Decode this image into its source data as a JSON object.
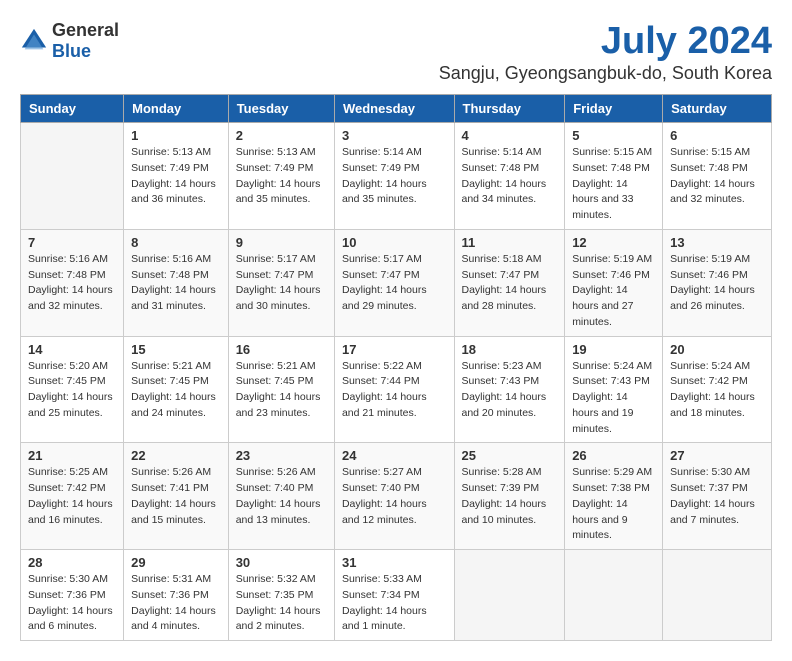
{
  "logo": {
    "general": "General",
    "blue": "Blue"
  },
  "title": "July 2024",
  "subtitle": "Sangju, Gyeongsangbuk-do, South Korea",
  "header": {
    "days": [
      "Sunday",
      "Monday",
      "Tuesday",
      "Wednesday",
      "Thursday",
      "Friday",
      "Saturday"
    ]
  },
  "weeks": [
    {
      "cells": [
        {
          "empty": true
        },
        {
          "day": "1",
          "rise": "Sunrise: 5:13 AM",
          "set": "Sunset: 7:49 PM",
          "daylight": "Daylight: 14 hours and 36 minutes."
        },
        {
          "day": "2",
          "rise": "Sunrise: 5:13 AM",
          "set": "Sunset: 7:49 PM",
          "daylight": "Daylight: 14 hours and 35 minutes."
        },
        {
          "day": "3",
          "rise": "Sunrise: 5:14 AM",
          "set": "Sunset: 7:49 PM",
          "daylight": "Daylight: 14 hours and 35 minutes."
        },
        {
          "day": "4",
          "rise": "Sunrise: 5:14 AM",
          "set": "Sunset: 7:48 PM",
          "daylight": "Daylight: 14 hours and 34 minutes."
        },
        {
          "day": "5",
          "rise": "Sunrise: 5:15 AM",
          "set": "Sunset: 7:48 PM",
          "daylight": "Daylight: 14 hours and 33 minutes."
        },
        {
          "day": "6",
          "rise": "Sunrise: 5:15 AM",
          "set": "Sunset: 7:48 PM",
          "daylight": "Daylight: 14 hours and 32 minutes."
        }
      ]
    },
    {
      "cells": [
        {
          "day": "7",
          "rise": "Sunrise: 5:16 AM",
          "set": "Sunset: 7:48 PM",
          "daylight": "Daylight: 14 hours and 32 minutes."
        },
        {
          "day": "8",
          "rise": "Sunrise: 5:16 AM",
          "set": "Sunset: 7:48 PM",
          "daylight": "Daylight: 14 hours and 31 minutes."
        },
        {
          "day": "9",
          "rise": "Sunrise: 5:17 AM",
          "set": "Sunset: 7:47 PM",
          "daylight": "Daylight: 14 hours and 30 minutes."
        },
        {
          "day": "10",
          "rise": "Sunrise: 5:17 AM",
          "set": "Sunset: 7:47 PM",
          "daylight": "Daylight: 14 hours and 29 minutes."
        },
        {
          "day": "11",
          "rise": "Sunrise: 5:18 AM",
          "set": "Sunset: 7:47 PM",
          "daylight": "Daylight: 14 hours and 28 minutes."
        },
        {
          "day": "12",
          "rise": "Sunrise: 5:19 AM",
          "set": "Sunset: 7:46 PM",
          "daylight": "Daylight: 14 hours and 27 minutes."
        },
        {
          "day": "13",
          "rise": "Sunrise: 5:19 AM",
          "set": "Sunset: 7:46 PM",
          "daylight": "Daylight: 14 hours and 26 minutes."
        }
      ]
    },
    {
      "cells": [
        {
          "day": "14",
          "rise": "Sunrise: 5:20 AM",
          "set": "Sunset: 7:45 PM",
          "daylight": "Daylight: 14 hours and 25 minutes."
        },
        {
          "day": "15",
          "rise": "Sunrise: 5:21 AM",
          "set": "Sunset: 7:45 PM",
          "daylight": "Daylight: 14 hours and 24 minutes."
        },
        {
          "day": "16",
          "rise": "Sunrise: 5:21 AM",
          "set": "Sunset: 7:45 PM",
          "daylight": "Daylight: 14 hours and 23 minutes."
        },
        {
          "day": "17",
          "rise": "Sunrise: 5:22 AM",
          "set": "Sunset: 7:44 PM",
          "daylight": "Daylight: 14 hours and 21 minutes."
        },
        {
          "day": "18",
          "rise": "Sunrise: 5:23 AM",
          "set": "Sunset: 7:43 PM",
          "daylight": "Daylight: 14 hours and 20 minutes."
        },
        {
          "day": "19",
          "rise": "Sunrise: 5:24 AM",
          "set": "Sunset: 7:43 PM",
          "daylight": "Daylight: 14 hours and 19 minutes."
        },
        {
          "day": "20",
          "rise": "Sunrise: 5:24 AM",
          "set": "Sunset: 7:42 PM",
          "daylight": "Daylight: 14 hours and 18 minutes."
        }
      ]
    },
    {
      "cells": [
        {
          "day": "21",
          "rise": "Sunrise: 5:25 AM",
          "set": "Sunset: 7:42 PM",
          "daylight": "Daylight: 14 hours and 16 minutes."
        },
        {
          "day": "22",
          "rise": "Sunrise: 5:26 AM",
          "set": "Sunset: 7:41 PM",
          "daylight": "Daylight: 14 hours and 15 minutes."
        },
        {
          "day": "23",
          "rise": "Sunrise: 5:26 AM",
          "set": "Sunset: 7:40 PM",
          "daylight": "Daylight: 14 hours and 13 minutes."
        },
        {
          "day": "24",
          "rise": "Sunrise: 5:27 AM",
          "set": "Sunset: 7:40 PM",
          "daylight": "Daylight: 14 hours and 12 minutes."
        },
        {
          "day": "25",
          "rise": "Sunrise: 5:28 AM",
          "set": "Sunset: 7:39 PM",
          "daylight": "Daylight: 14 hours and 10 minutes."
        },
        {
          "day": "26",
          "rise": "Sunrise: 5:29 AM",
          "set": "Sunset: 7:38 PM",
          "daylight": "Daylight: 14 hours and 9 minutes."
        },
        {
          "day": "27",
          "rise": "Sunrise: 5:30 AM",
          "set": "Sunset: 7:37 PM",
          "daylight": "Daylight: 14 hours and 7 minutes."
        }
      ]
    },
    {
      "cells": [
        {
          "day": "28",
          "rise": "Sunrise: 5:30 AM",
          "set": "Sunset: 7:36 PM",
          "daylight": "Daylight: 14 hours and 6 minutes."
        },
        {
          "day": "29",
          "rise": "Sunrise: 5:31 AM",
          "set": "Sunset: 7:36 PM",
          "daylight": "Daylight: 14 hours and 4 minutes."
        },
        {
          "day": "30",
          "rise": "Sunrise: 5:32 AM",
          "set": "Sunset: 7:35 PM",
          "daylight": "Daylight: 14 hours and 2 minutes."
        },
        {
          "day": "31",
          "rise": "Sunrise: 5:33 AM",
          "set": "Sunset: 7:34 PM",
          "daylight": "Daylight: 14 hours and 1 minute."
        },
        {
          "empty": true
        },
        {
          "empty": true
        },
        {
          "empty": true
        }
      ]
    }
  ]
}
